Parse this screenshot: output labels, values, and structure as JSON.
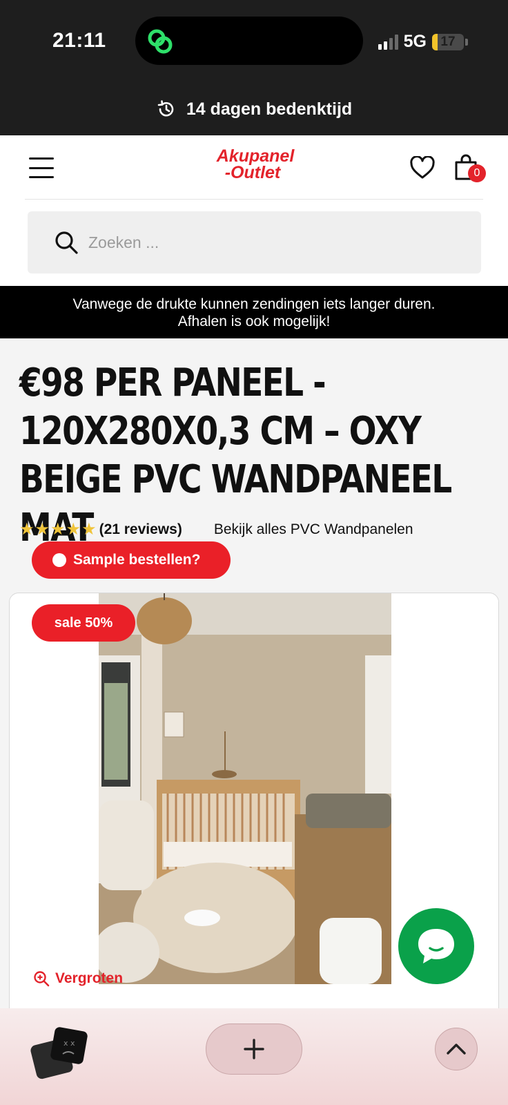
{
  "status_bar": {
    "time": "21:11",
    "network": "5G",
    "battery": "17",
    "battery_level_percent": 17,
    "island_app_icon": "link-app-icon"
  },
  "announcement": {
    "icon": "history-icon",
    "text": "14 dagen bedenktijd"
  },
  "header": {
    "logo_line1": "Akupanel",
    "logo_line2": "-Outlet",
    "cart_count": "0",
    "search_placeholder": "Zoeken ..."
  },
  "notice": {
    "line1": "Vanwege de drukte kunnen zendingen iets langer duren.",
    "line2": "Afhalen is ook mogelijk!"
  },
  "product": {
    "title": "€98 per paneel - 120x280x0,3 cm – Oxy beige PVC wandpaneel mat",
    "rating_stars": 5,
    "reviews": "(21 reviews)",
    "collection_link": "Bekijk alles PVC Wandpanelen",
    "sample_button": "Sample bestellen?",
    "sale_badge": "sale 50%",
    "enlarge": "Vergroten"
  },
  "colors": {
    "brand_red": "#e3232b",
    "chat_green": "#0aa14a",
    "dark": "#1e1e1e"
  },
  "bottom_bar": {
    "tabs_icon": "tabs-icon",
    "new_tab_icon": "plus-icon",
    "scroll_icon": "chevron-up-icon"
  }
}
